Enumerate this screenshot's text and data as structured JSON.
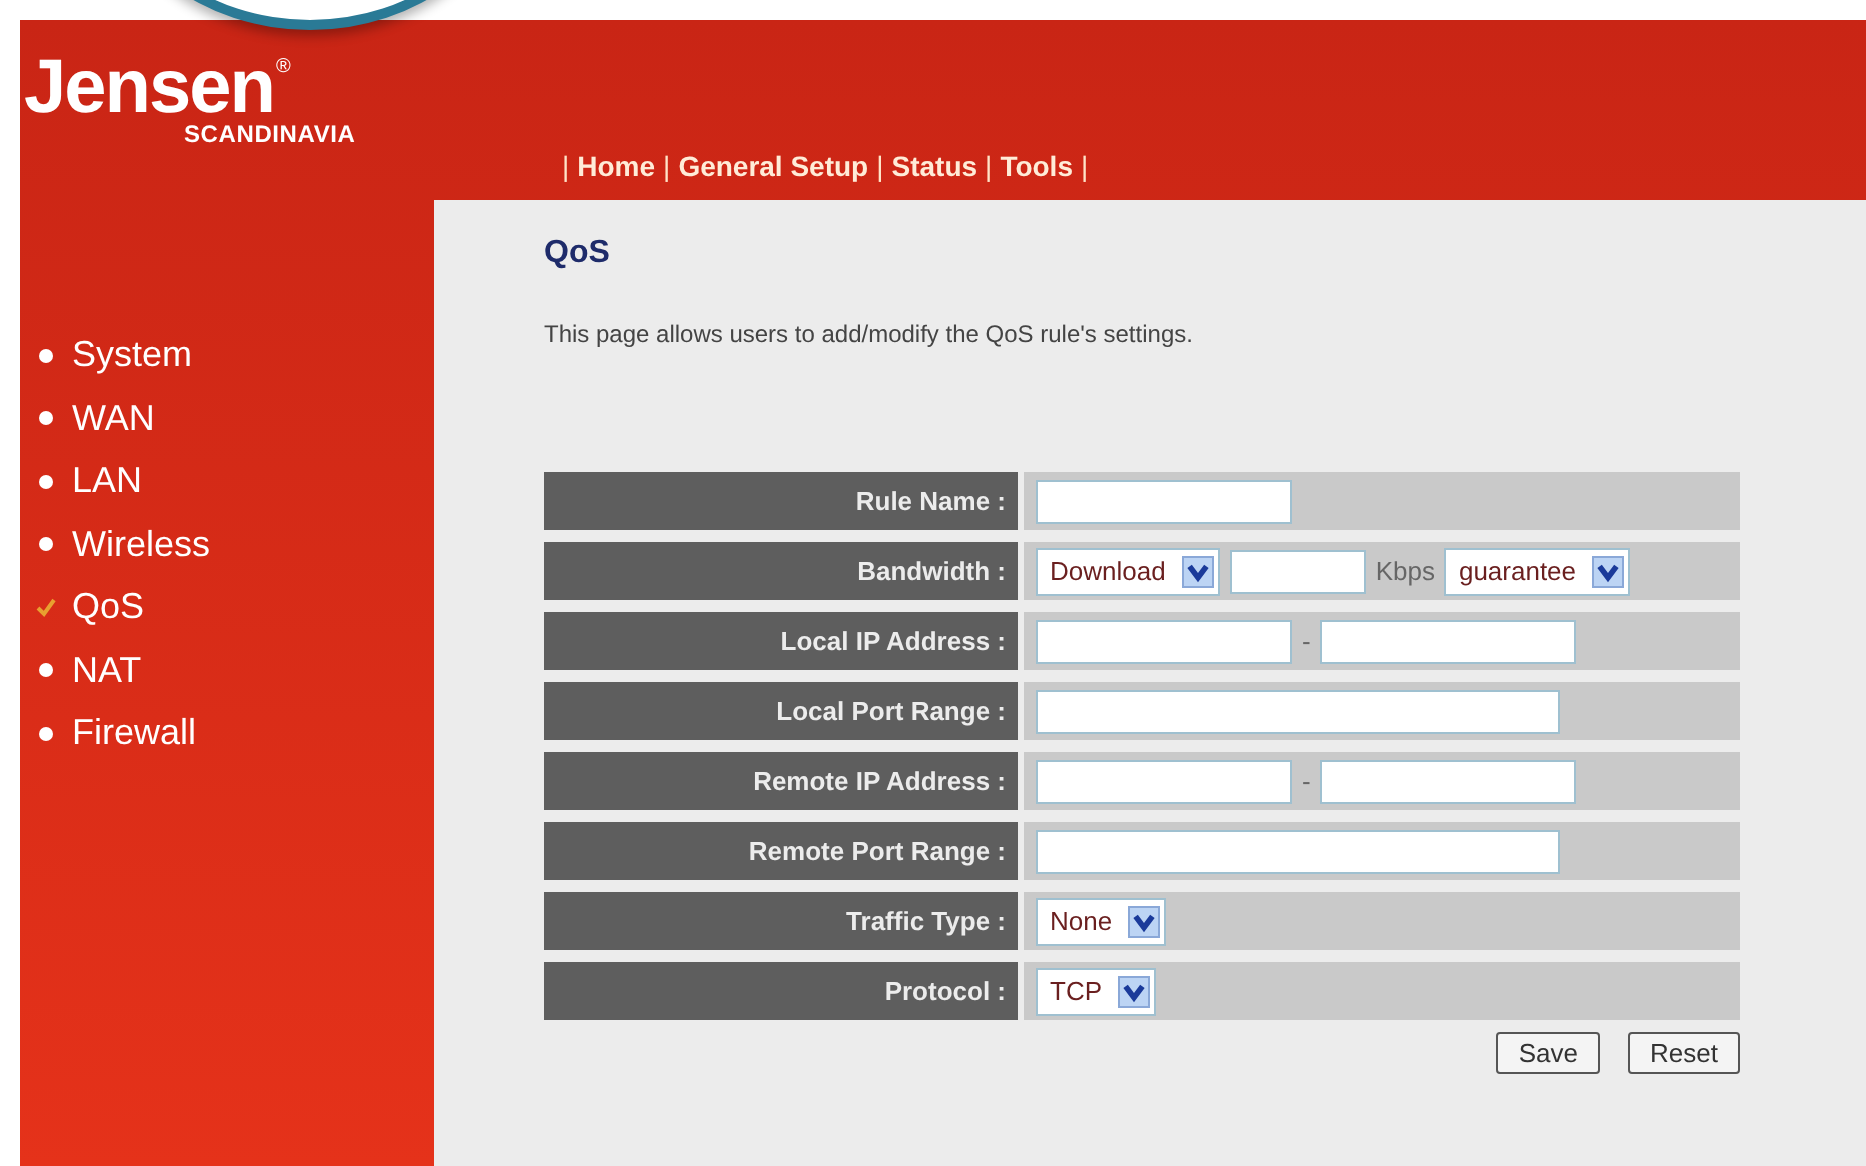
{
  "logo": {
    "name": "Jensen",
    "registered": "®",
    "tagline": "SCANDINAVIA"
  },
  "top_nav": {
    "separator": "|",
    "items": [
      {
        "label": "Home"
      },
      {
        "label": "General Setup"
      },
      {
        "label": "Status"
      },
      {
        "label": "Tools"
      }
    ]
  },
  "sidebar": {
    "items": [
      {
        "label": "System",
        "selected": false
      },
      {
        "label": "WAN",
        "selected": false
      },
      {
        "label": "LAN",
        "selected": false
      },
      {
        "label": "Wireless",
        "selected": false
      },
      {
        "label": "QoS",
        "selected": true
      },
      {
        "label": "NAT",
        "selected": false
      },
      {
        "label": "Firewall",
        "selected": false
      }
    ]
  },
  "page": {
    "title": "QoS",
    "description": "This page allows users to add/modify the QoS rule's settings."
  },
  "form": {
    "rows": [
      {
        "label": "Rule Name :",
        "kind": "text"
      },
      {
        "label": "Bandwidth :",
        "kind": "bandwidth",
        "direction": "Download",
        "unit": "Kbps",
        "mode": "guarantee"
      },
      {
        "label": "Local IP Address :",
        "kind": "range",
        "separator": "-"
      },
      {
        "label": "Local Port Range :",
        "kind": "wide"
      },
      {
        "label": "Remote IP Address :",
        "kind": "range",
        "separator": "-"
      },
      {
        "label": "Remote Port Range :",
        "kind": "wide"
      },
      {
        "label": "Traffic Type :",
        "kind": "select",
        "value": "None"
      },
      {
        "label": "Protocol :",
        "kind": "select",
        "value": "TCP"
      }
    ],
    "buttons": [
      "Save",
      "Reset"
    ]
  }
}
